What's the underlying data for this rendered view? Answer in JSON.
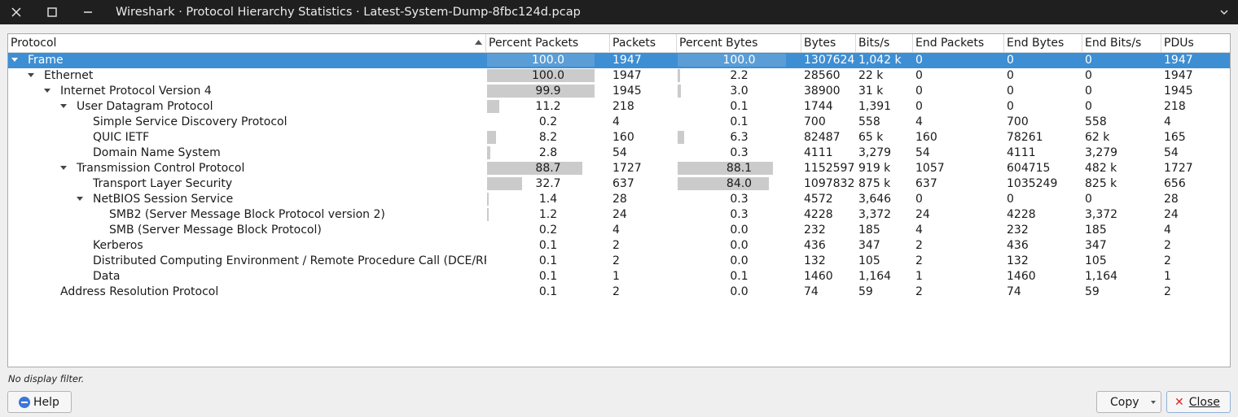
{
  "window": {
    "title": "Wireshark · Protocol Hierarchy Statistics · Latest-System-Dump-8fbc124d.pcap"
  },
  "columns": [
    "Protocol",
    "Percent Packets",
    "Packets",
    "Percent Bytes",
    "Bytes",
    "Bits/s",
    "End Packets",
    "End Bytes",
    "End Bits/s",
    "PDUs"
  ],
  "rows": [
    {
      "protocol": "Frame",
      "level": 0,
      "expanded": true,
      "selected": true,
      "pct_packets": "100.0",
      "packets": "1947",
      "pct_bytes": "100.0",
      "bytes": "1307624",
      "bits": "1,042 k",
      "end_packets": "0",
      "end_bytes": "0",
      "end_bits": "0",
      "pdus": "1947"
    },
    {
      "protocol": "Ethernet",
      "level": 1,
      "expanded": true,
      "pct_packets": "100.0",
      "packets": "1947",
      "pct_bytes": "2.2",
      "bytes": "28560",
      "bits": "22 k",
      "end_packets": "0",
      "end_bytes": "0",
      "end_bits": "0",
      "pdus": "1947"
    },
    {
      "protocol": "Internet Protocol Version 4",
      "level": 2,
      "expanded": true,
      "pct_packets": "99.9",
      "packets": "1945",
      "pct_bytes": "3.0",
      "bytes": "38900",
      "bits": "31 k",
      "end_packets": "0",
      "end_bytes": "0",
      "end_bits": "0",
      "pdus": "1945"
    },
    {
      "protocol": "User Datagram Protocol",
      "level": 3,
      "expanded": true,
      "pct_packets": "11.2",
      "packets": "218",
      "pct_bytes": "0.1",
      "bytes": "1744",
      "bits": "1,391",
      "end_packets": "0",
      "end_bytes": "0",
      "end_bits": "0",
      "pdus": "218"
    },
    {
      "protocol": "Simple Service Discovery Protocol",
      "level": 4,
      "pct_packets": "0.2",
      "packets": "4",
      "pct_bytes": "0.1",
      "bytes": "700",
      "bits": "558",
      "end_packets": "4",
      "end_bytes": "700",
      "end_bits": "558",
      "pdus": "4"
    },
    {
      "protocol": "QUIC IETF",
      "level": 4,
      "pct_packets": "8.2",
      "packets": "160",
      "pct_bytes": "6.3",
      "bytes": "82487",
      "bits": "65 k",
      "end_packets": "160",
      "end_bytes": "78261",
      "end_bits": "62 k",
      "pdus": "165"
    },
    {
      "protocol": "Domain Name System",
      "level": 4,
      "pct_packets": "2.8",
      "packets": "54",
      "pct_bytes": "0.3",
      "bytes": "4111",
      "bits": "3,279",
      "end_packets": "54",
      "end_bytes": "4111",
      "end_bits": "3,279",
      "pdus": "54"
    },
    {
      "protocol": "Transmission Control Protocol",
      "level": 3,
      "expanded": true,
      "pct_packets": "88.7",
      "packets": "1727",
      "pct_bytes": "88.1",
      "bytes": "1152597",
      "bits": "919 k",
      "end_packets": "1057",
      "end_bytes": "604715",
      "end_bits": "482 k",
      "pdus": "1727"
    },
    {
      "protocol": "Transport Layer Security",
      "level": 4,
      "pct_packets": "32.7",
      "packets": "637",
      "pct_bytes": "84.0",
      "bytes": "1097832",
      "bits": "875 k",
      "end_packets": "637",
      "end_bytes": "1035249",
      "end_bits": "825 k",
      "pdus": "656"
    },
    {
      "protocol": "NetBIOS Session Service",
      "level": 4,
      "expanded": true,
      "pct_packets": "1.4",
      "packets": "28",
      "pct_bytes": "0.3",
      "bytes": "4572",
      "bits": "3,646",
      "end_packets": "0",
      "end_bytes": "0",
      "end_bits": "0",
      "pdus": "28"
    },
    {
      "protocol": "SMB2 (Server Message Block Protocol version 2)",
      "level": 5,
      "pct_packets": "1.2",
      "packets": "24",
      "pct_bytes": "0.3",
      "bytes": "4228",
      "bits": "3,372",
      "end_packets": "24",
      "end_bytes": "4228",
      "end_bits": "3,372",
      "pdus": "24"
    },
    {
      "protocol": "SMB (Server Message Block Protocol)",
      "level": 5,
      "pct_packets": "0.2",
      "packets": "4",
      "pct_bytes": "0.0",
      "bytes": "232",
      "bits": "185",
      "end_packets": "4",
      "end_bytes": "232",
      "end_bits": "185",
      "pdus": "4"
    },
    {
      "protocol": "Kerberos",
      "level": 4,
      "pct_packets": "0.1",
      "packets": "2",
      "pct_bytes": "0.0",
      "bytes": "436",
      "bits": "347",
      "end_packets": "2",
      "end_bytes": "436",
      "end_bits": "347",
      "pdus": "2"
    },
    {
      "protocol": "Distributed Computing Environment / Remote Procedure Call (DCE/RPC)",
      "level": 4,
      "pct_packets": "0.1",
      "packets": "2",
      "pct_bytes": "0.0",
      "bytes": "132",
      "bits": "105",
      "end_packets": "2",
      "end_bytes": "132",
      "end_bits": "105",
      "pdus": "2"
    },
    {
      "protocol": "Data",
      "level": 4,
      "pct_packets": "0.1",
      "packets": "1",
      "pct_bytes": "0.1",
      "bytes": "1460",
      "bits": "1,164",
      "end_packets": "1",
      "end_bytes": "1460",
      "end_bits": "1,164",
      "pdus": "1"
    },
    {
      "protocol": "Address Resolution Protocol",
      "level": 2,
      "pct_packets": "0.1",
      "packets": "2",
      "pct_bytes": "0.0",
      "bytes": "74",
      "bits": "59",
      "end_packets": "2",
      "end_bytes": "74",
      "end_bits": "59",
      "pdus": "2"
    }
  ],
  "status": {
    "filter_text": "No display filter."
  },
  "buttons": {
    "help": "Help",
    "copy": "Copy",
    "close": "Close"
  },
  "icons": {
    "close_window": "x-icon",
    "maximize": "maximize-icon",
    "minimize": "minimize-icon",
    "help": "help-circle-icon"
  },
  "colors": {
    "selection": "#3d8ed3",
    "bar": "#cbcbcb",
    "titlebar": "#1f1f1f"
  }
}
